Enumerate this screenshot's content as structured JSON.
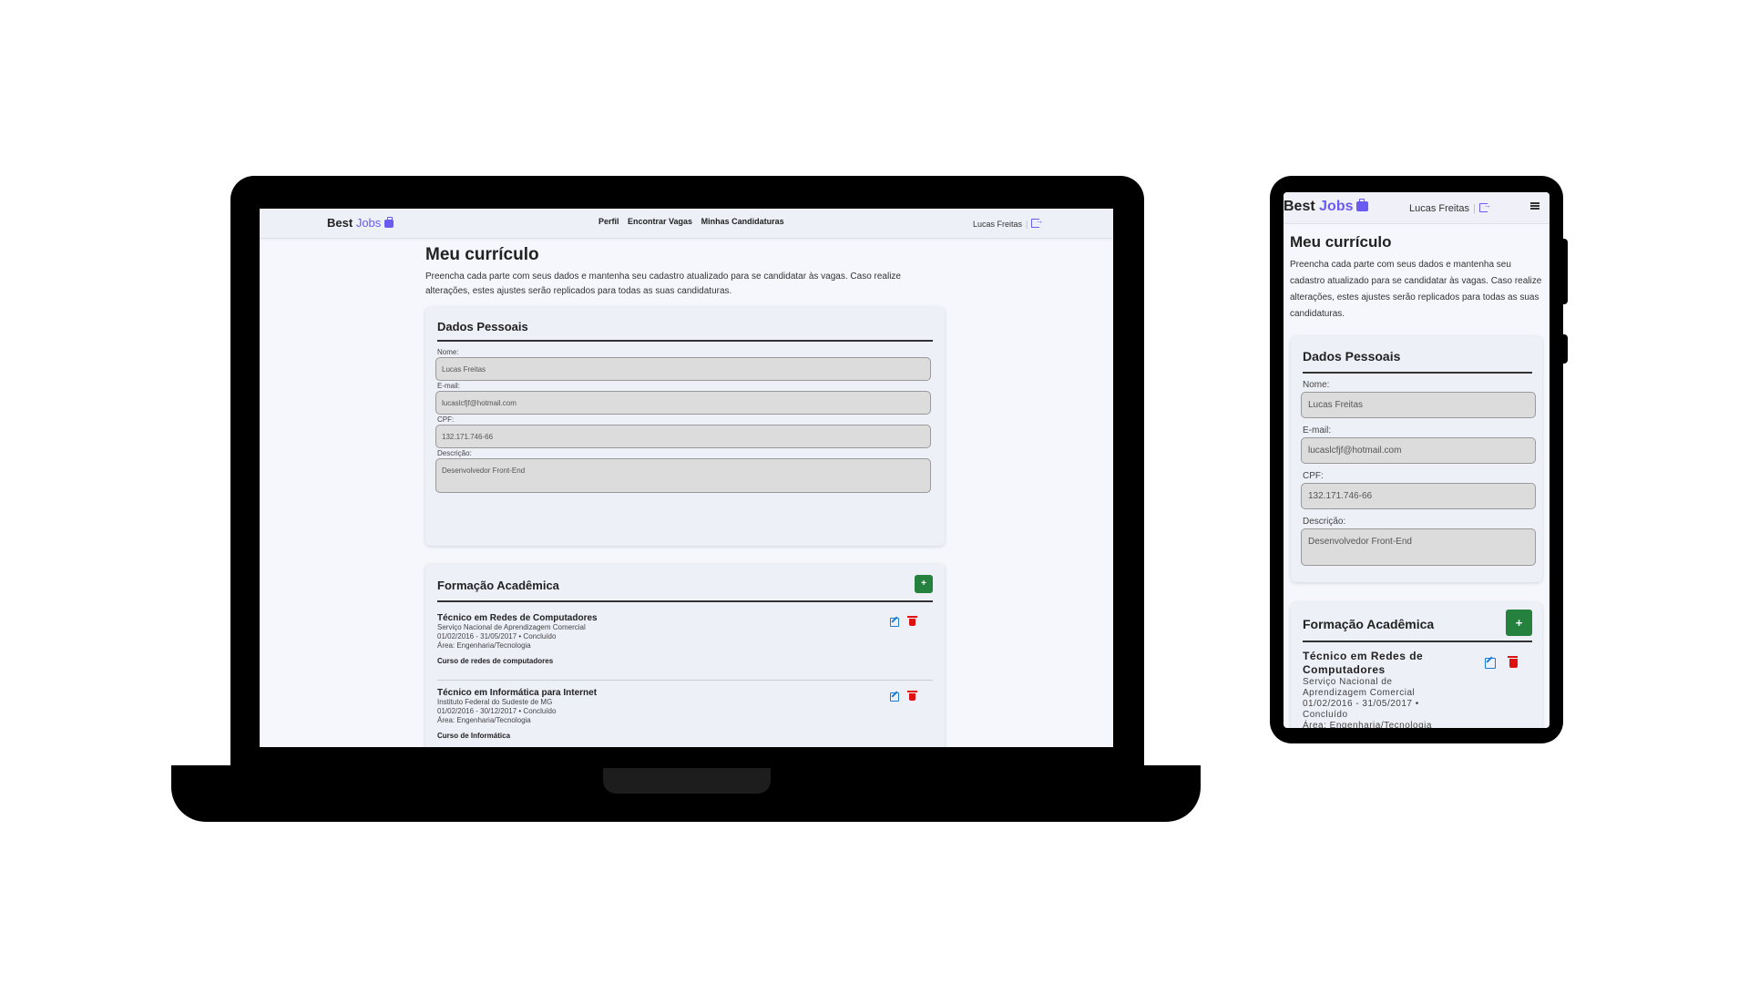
{
  "brand": {
    "best": "Best",
    "jobs": "Jobs"
  },
  "nav": {
    "perfil": "Perfil",
    "encontrar": "Encontrar Vagas",
    "candidaturas": "Minhas Candidaturas"
  },
  "user": {
    "name": "Lucas Freitas",
    "separator": "|"
  },
  "page": {
    "title": "Meu currículo",
    "intro": "Preencha cada parte com seus dados e mantenha seu cadastro atualizado para se candidatar às vagas. Caso realize alterações, estes ajustes serão replicados para todas as suas candidaturas."
  },
  "personal": {
    "title": "Dados Pessoais",
    "name_label": "Nome:",
    "name_value": "Lucas Freitas",
    "email_label": "E-mail:",
    "email_value": "lucaslcfjf@hotmail.com",
    "cpf_label": "CPF:",
    "cpf_value": "132.171.746-66",
    "desc_label": "Descrição:",
    "desc_value": "Desenvolvedor Front-End"
  },
  "education": {
    "title": "Formação Acadêmica",
    "add_label": "+",
    "items": [
      {
        "title": "Técnico em Redes de Computadores",
        "institution": "Serviço Nacional de Aprendizagem Comercial",
        "dates": "01/02/2016 - 31/05/2017 • Concluído",
        "area": "Área: Engenharia/Tecnologia",
        "description": "Curso de redes de computadores"
      },
      {
        "title": "Técnico em Informática para Internet",
        "institution": "Instituto Federal do Sudeste de MG",
        "dates": "01/02/2016 - 30/12/2017 • Concluído",
        "area": "Área: Engenharia/Tecnologia",
        "description": "Curso de Informática"
      }
    ]
  },
  "colors": {
    "brand": "#6a5cf0",
    "add_button": "#24823e",
    "edit_icon": "#1a7bd6",
    "delete_icon": "#e01010"
  }
}
